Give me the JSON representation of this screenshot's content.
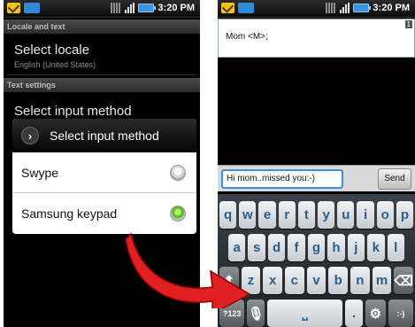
{
  "left_screen": {
    "status_time": "3:20 PM",
    "section_locale": "Locale and text",
    "select_locale_title": "Select locale",
    "select_locale_sub": "English (United States)",
    "section_text": "Text settings",
    "select_input_behind": "Select input method",
    "dialog": {
      "title": "Select input method",
      "options": [
        {
          "label": "Swype",
          "selected": false
        },
        {
          "label": "Samsung keypad",
          "selected": true
        }
      ]
    }
  },
  "right_screen": {
    "status_time": "3:20 PM",
    "recipient": "Mom <M>;",
    "counter": "1",
    "message_text": "Hi mom..missed you:-)",
    "send_label": "Send",
    "keyboard": {
      "row1": [
        "q",
        "w",
        "e",
        "r",
        "t",
        "y",
        "u",
        "i",
        "o",
        "p"
      ],
      "row2": [
        "a",
        "s",
        "d",
        "f",
        "g",
        "h",
        "j",
        "k",
        "l"
      ],
      "row3": [
        "z",
        "x",
        "c",
        "v",
        "b",
        "n",
        "m"
      ],
      "mode_key": "?123",
      "smiley_key": ":-)",
      "period_key": "."
    }
  },
  "colors": {
    "arrow": "#e02020",
    "accent_blue": "#3b8ee0",
    "radio_on": "#5bbf1f"
  }
}
